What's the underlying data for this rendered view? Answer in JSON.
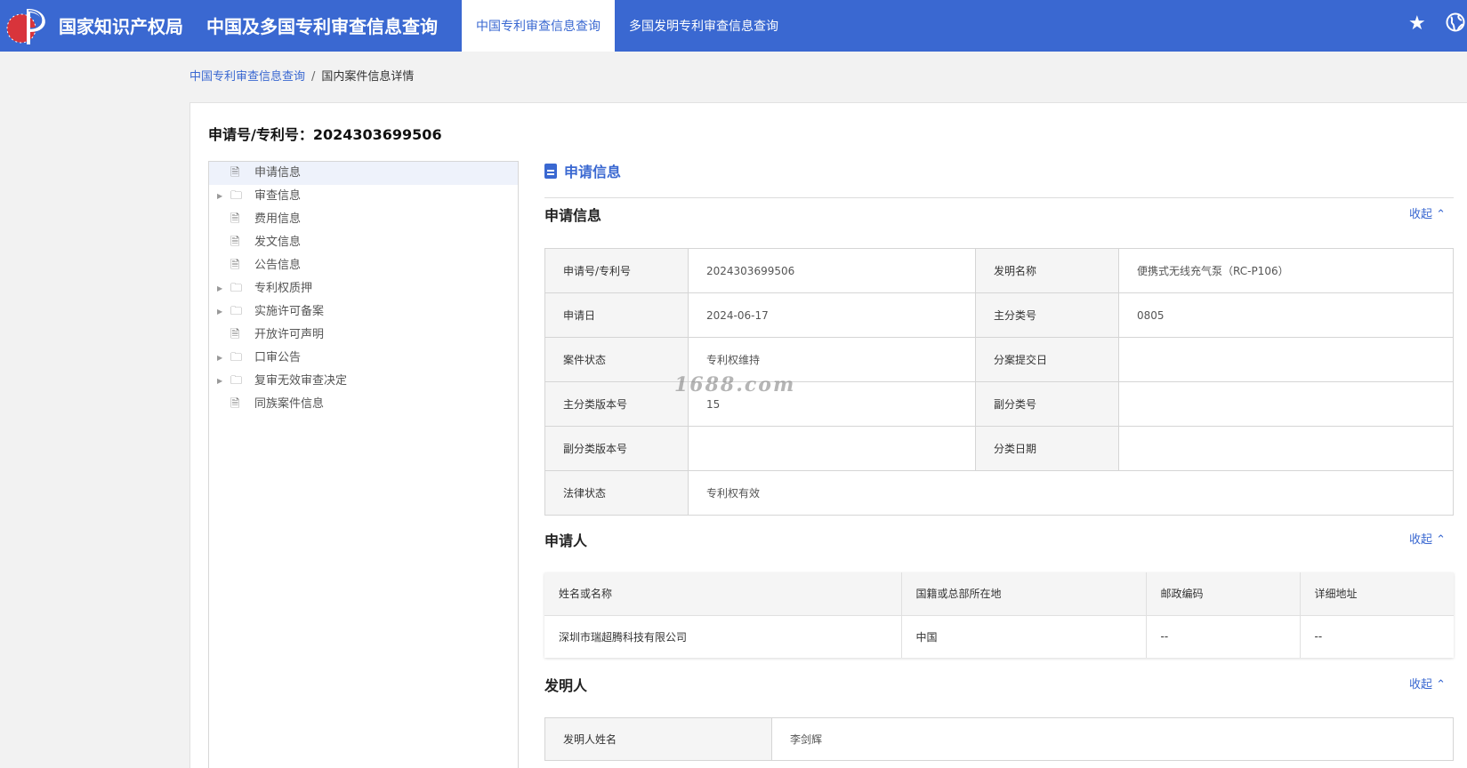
{
  "header": {
    "org_name": "国家知识产权局",
    "system_name": "中国及多国专利审查信息查询",
    "tabs": [
      {
        "label": "中国专利审查信息查询",
        "active": true
      },
      {
        "label": "多国发明专利审查信息查询",
        "active": false
      }
    ],
    "icons": [
      "star-icon",
      "globe-icon"
    ],
    "color": "#3a68d1"
  },
  "breadcrumb": {
    "root": "中国专利审查信息查询",
    "separator": "/",
    "current": "国内案件信息详情"
  },
  "application_number": "申请号/专利号：2024303699506",
  "tree": [
    {
      "label": "申请信息",
      "icon": "file-icon",
      "expandable": false,
      "selected": true
    },
    {
      "label": "审查信息",
      "icon": "folder-icon",
      "expandable": true
    },
    {
      "label": "费用信息",
      "icon": "file-icon",
      "expandable": false
    },
    {
      "label": "发文信息",
      "icon": "file-icon",
      "expandable": false
    },
    {
      "label": "公告信息",
      "icon": "file-icon",
      "expandable": false
    },
    {
      "label": "专利权质押",
      "icon": "folder-icon",
      "expandable": true
    },
    {
      "label": "实施许可备案",
      "icon": "folder-icon",
      "expandable": true
    },
    {
      "label": "开放许可声明",
      "icon": "file-icon",
      "expandable": false
    },
    {
      "label": "口审公告",
      "icon": "folder-icon",
      "expandable": true
    },
    {
      "label": "复审无效审查决定",
      "icon": "folder-icon",
      "expandable": true
    },
    {
      "label": "同族案件信息",
      "icon": "file-icon",
      "expandable": false
    }
  ],
  "panel_title": "申请信息",
  "sections": {
    "application_info": {
      "title": "申请信息",
      "collapse": "收起",
      "rows": [
        [
          "申请号/专利号",
          "2024303699506",
          "发明名称",
          "便携式无线充气泵（RC-P106）"
        ],
        [
          "申请日",
          "2024-06-17",
          "主分类号",
          "0805"
        ],
        [
          "案件状态",
          "专利权维持",
          "分案提交日",
          ""
        ],
        [
          "主分类版本号",
          "15",
          "副分类号",
          ""
        ],
        [
          "副分类版本号",
          "",
          "分类日期",
          ""
        ],
        [
          "法律状态",
          "专利权有效"
        ]
      ]
    },
    "applicant": {
      "title": "申请人",
      "collapse": "收起",
      "headers": [
        "姓名或名称",
        "国籍或总部所在地",
        "邮政编码",
        "详细地址"
      ],
      "rows": [
        [
          "深圳市瑞超腾科技有限公司",
          "中国",
          "--",
          "--"
        ]
      ]
    },
    "inventor": {
      "title": "发明人",
      "collapse": "收起",
      "label": "发明人姓名",
      "value": "李剑辉"
    }
  },
  "watermark": "1688.com"
}
